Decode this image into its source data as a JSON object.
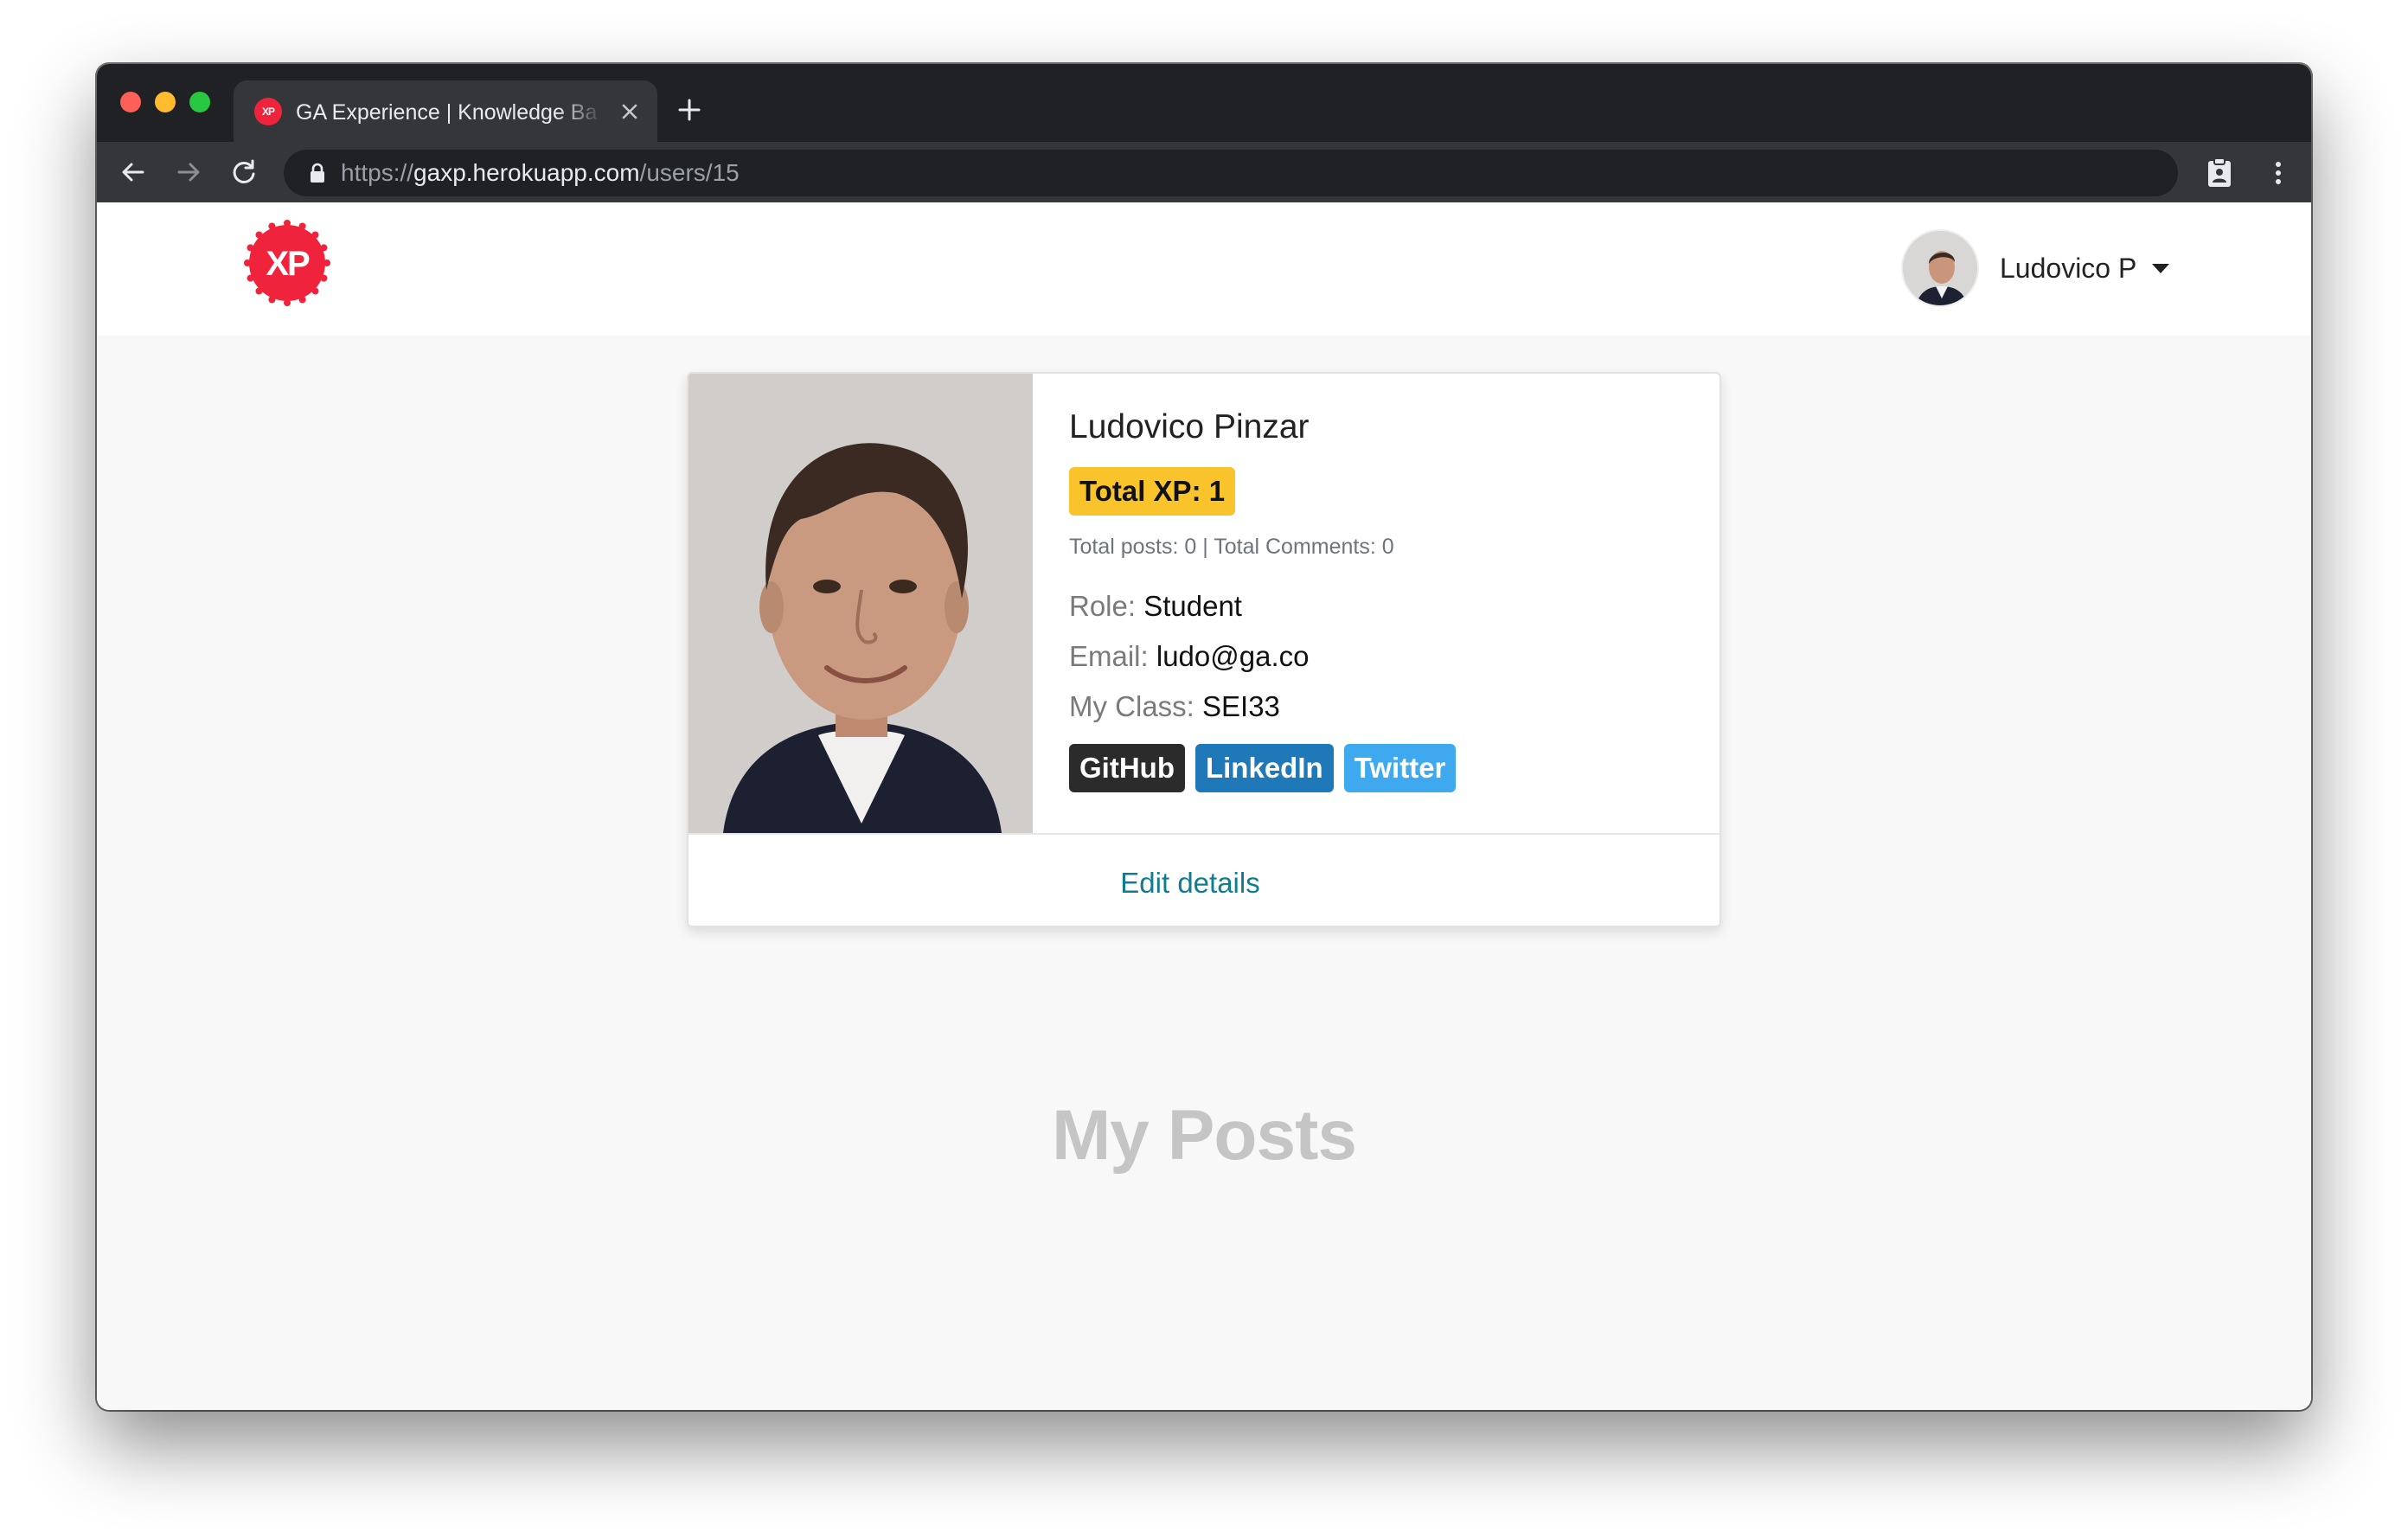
{
  "browser": {
    "tab": {
      "title": "GA Experience | Knowledge Ba",
      "favicon_text": "XP"
    },
    "address_bar": {
      "scheme": "https://",
      "host": "gaxp.herokuapp.com",
      "path": "/users/15"
    },
    "icons": {
      "close": "close-icon",
      "new_tab": "plus-icon",
      "back": "arrow-back-icon",
      "forward": "arrow-forward-icon",
      "reload": "reload-icon",
      "lock": "lock-icon",
      "extension": "clipboard-badge-icon",
      "menu": "kebab-menu-icon"
    }
  },
  "header": {
    "logo_text": "XP",
    "user_menu": {
      "display_name": "Ludovico P"
    }
  },
  "profile": {
    "name": "Ludovico Pinzar",
    "xp_badge": "Total XP: 1",
    "stats": "Total posts: 0 | Total Comments: 0",
    "details": {
      "role_label": "Role:",
      "role_value": "Student",
      "email_label": "Email:",
      "email_value": "ludo@ga.co",
      "class_label": "My Class:",
      "class_value": "SEI33"
    },
    "social": {
      "github": "GitHub",
      "linkedin": "LinkedIn",
      "twitter": "Twitter"
    },
    "edit_link": "Edit details"
  },
  "posts": {
    "heading": "My Posts"
  },
  "colors": {
    "brand_red": "#ef233c",
    "xp_badge": "#f9c32b",
    "github": "#2b2b2b",
    "linkedin": "#1f78b8",
    "twitter": "#3fa9f0",
    "link": "#0f7d8f"
  }
}
